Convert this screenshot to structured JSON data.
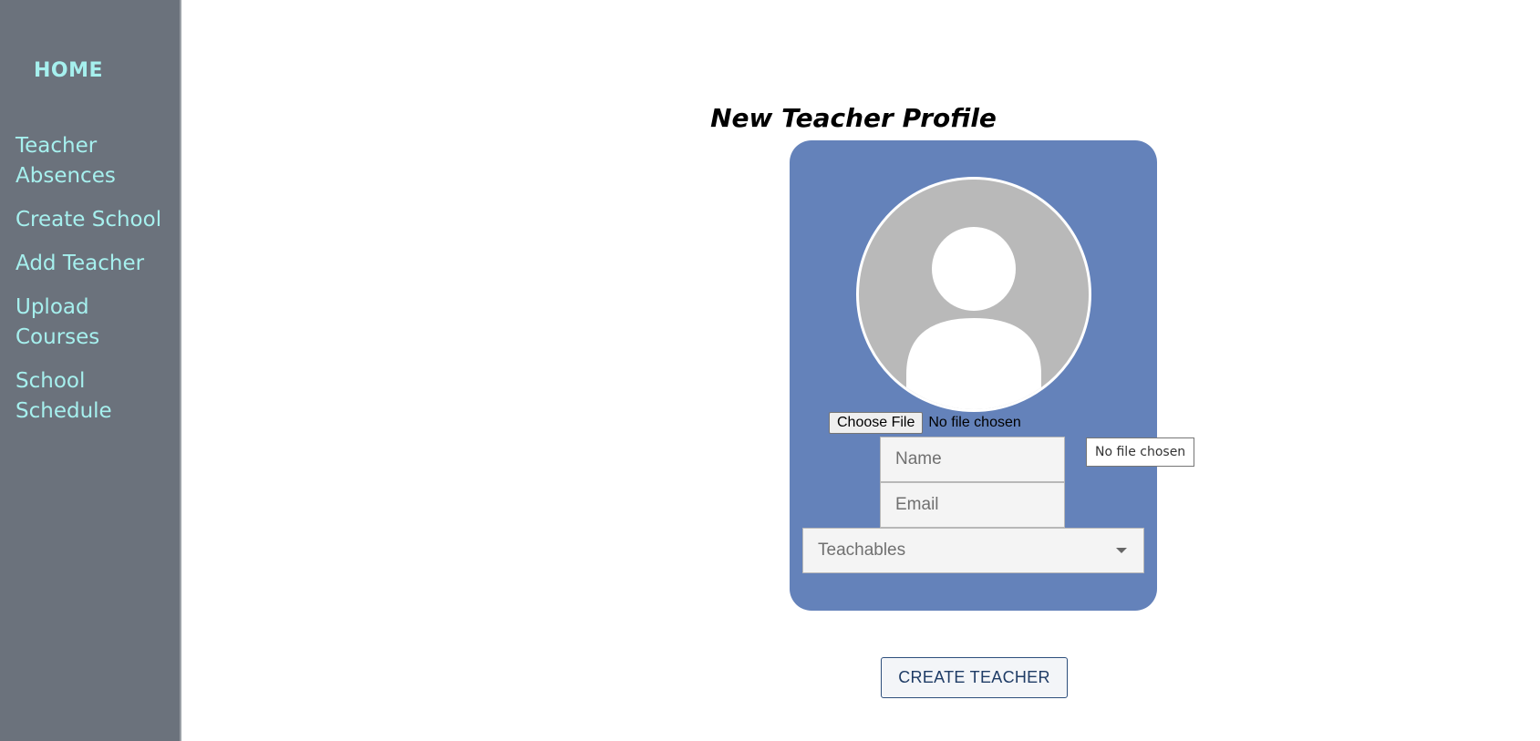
{
  "sidebar": {
    "home_label": "HOME",
    "items": [
      {
        "label": "Teacher Absences"
      },
      {
        "label": "Create School"
      },
      {
        "label": "Add Teacher"
      },
      {
        "label": "Upload Courses"
      },
      {
        "label": "School Schedule"
      }
    ]
  },
  "form": {
    "title": "New Teacher Profile",
    "avatar_icon": "default-user-avatar",
    "file_button_label": "Choose File",
    "file_status": "No file chosen",
    "name_placeholder": "Name",
    "email_placeholder": "Email",
    "teachables_label": "Teachables"
  },
  "tooltip": {
    "text": "No file chosen"
  },
  "actions": {
    "create_label": "CREATE TEACHER"
  },
  "colors": {
    "sidebar_bg": "#6b727c",
    "nav_text": "#a6f0ee",
    "card_bg": "#6482ba",
    "avatar_bg": "#b9b9b9",
    "button_text": "#1f3c66"
  }
}
